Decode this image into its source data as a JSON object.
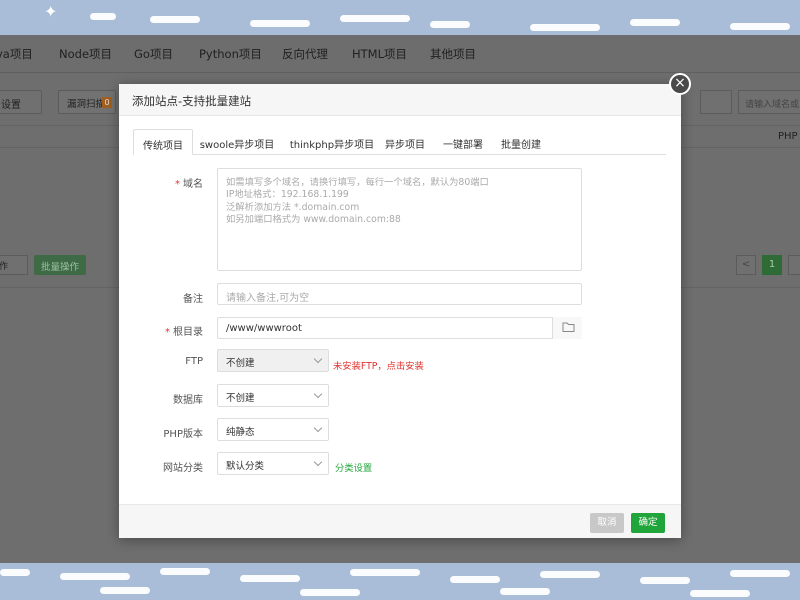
{
  "background_app": {
    "nav_tabs": [
      "va项目",
      "Node项目",
      "Go项目",
      "Python项目",
      "反向代理",
      "HTML项目",
      "其他项目"
    ],
    "toolbar": {
      "select_text": "设置",
      "button_text": "漏洞扫描",
      "badge": "0",
      "search_placeholder": "请输入域名或"
    },
    "column_header": "PHP",
    "bulk": {
      "select_text": "作",
      "button": "批量操作"
    },
    "pagination": {
      "prev": "<",
      "current": "1"
    }
  },
  "modal": {
    "title": "添加站点-支持批量建站",
    "close": "×",
    "tabs": [
      {
        "label": "传统项目",
        "active": true
      },
      {
        "label": "swoole异步项目",
        "active": false
      },
      {
        "label": "thinkphp异步项目",
        "active": false
      },
      {
        "label": "异步项目",
        "active": false
      },
      {
        "label": "一键部署",
        "active": false
      },
      {
        "label": "批量创建",
        "active": false
      }
    ],
    "form": {
      "domain": {
        "label": "域名",
        "required_mark": "*",
        "placeholder_lines": [
          "如需填写多个域名，请换行填写，每行一个域名，默认为80端口",
          "IP地址格式：192.168.1.199",
          "泛解析添加方法 *.domain.com",
          "如另加端口格式为 www.domain.com:88"
        ]
      },
      "remark": {
        "label": "备注",
        "placeholder": "请输入备注,可为空"
      },
      "root_dir": {
        "label": "根目录",
        "required_mark": "*",
        "value": "/www/wwwroot"
      },
      "ftp": {
        "label": "FTP",
        "value": "不创建",
        "hint": "未安装FTP，点击安装"
      },
      "database": {
        "label": "数据库",
        "value": "不创建"
      },
      "php_version": {
        "label": "PHP版本",
        "value": "纯静态"
      },
      "site_category": {
        "label": "网站分类",
        "value": "默认分类",
        "hint": "分类设置"
      }
    },
    "footer": {
      "cancel": "取消",
      "confirm": "确定"
    }
  },
  "colors": {
    "accent_green": "#20a53a",
    "error_red": "#e0322d",
    "overlay_gray": "#6e6e6e",
    "sky_blue": "#a9bdd8"
  }
}
